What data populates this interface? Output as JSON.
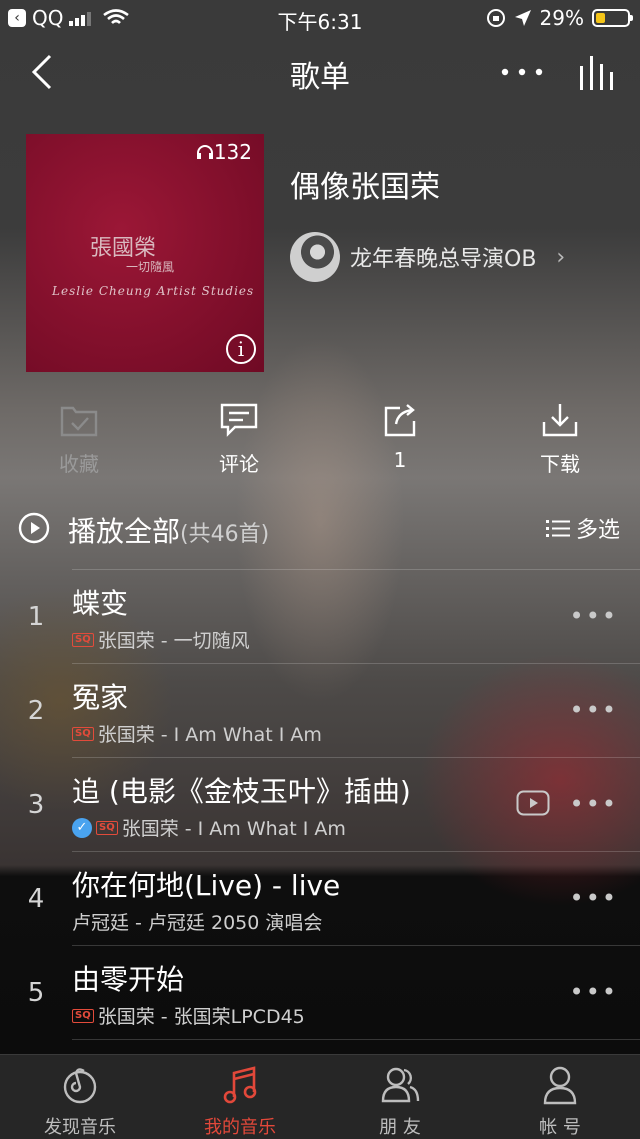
{
  "status_bar": {
    "carrier": "QQ",
    "time": "下午6:31",
    "battery": "29%",
    "battery_level": 0.29,
    "battery_color": "#f5c518"
  },
  "nav": {
    "title": "歌单",
    "back_icon": "chevron-left-icon",
    "more_icon": "more-horizontal-icon",
    "playing_icon": "equalizer-bars-icon"
  },
  "playlist": {
    "play_count": "132",
    "cover_logo_cn": "張國榮",
    "cover_logo_sub": "一切隨風",
    "cover_logo_en": "Leslie Cheung Artist Studies",
    "title": "偶像张国荣",
    "creator": "龙年春晚总导演OB"
  },
  "actions": [
    {
      "label": "收藏",
      "icon": "folder-check-icon",
      "dim": true
    },
    {
      "label": "评论",
      "icon": "comment-icon",
      "dim": false
    },
    {
      "label": "1",
      "icon": "share-icon",
      "dim": false
    },
    {
      "label": "下载",
      "icon": "download-icon",
      "dim": false
    }
  ],
  "list_header": {
    "play_all": "播放全部",
    "count": "(共46首)",
    "multi_select": "多选"
  },
  "songs": [
    {
      "index": "1",
      "name": "蝶变",
      "badge": "SQ",
      "verified": false,
      "mv": false,
      "meta": "张国荣 - 一切随风"
    },
    {
      "index": "2",
      "name": "冤家",
      "badge": "SQ",
      "verified": false,
      "mv": false,
      "meta": "张国荣 - I Am What I Am"
    },
    {
      "index": "3",
      "name": "追 (电影《金枝玉叶》插曲)",
      "badge": "SQ",
      "verified": true,
      "mv": true,
      "meta": "张国荣 - I Am What I Am"
    },
    {
      "index": "4",
      "name": "你在何地(Live) - live",
      "badge": "",
      "verified": false,
      "mv": false,
      "meta": "卢冠廷 - 卢冠廷 2050 演唱会"
    },
    {
      "index": "5",
      "name": "由零开始",
      "badge": "SQ",
      "verified": false,
      "mv": false,
      "meta": "张国荣 - 张国荣LPCD45"
    }
  ],
  "tabs": [
    {
      "label": "发现音乐",
      "icon": "netease-music-icon",
      "active": false
    },
    {
      "label": "我的音乐",
      "icon": "music-note-icon",
      "active": true
    },
    {
      "label": "朋 友",
      "icon": "friends-icon",
      "active": false
    },
    {
      "label": "帐 号",
      "icon": "account-icon",
      "active": false
    }
  ],
  "colors": {
    "accent": "#e2483a",
    "cover": "#8a0f2e"
  }
}
